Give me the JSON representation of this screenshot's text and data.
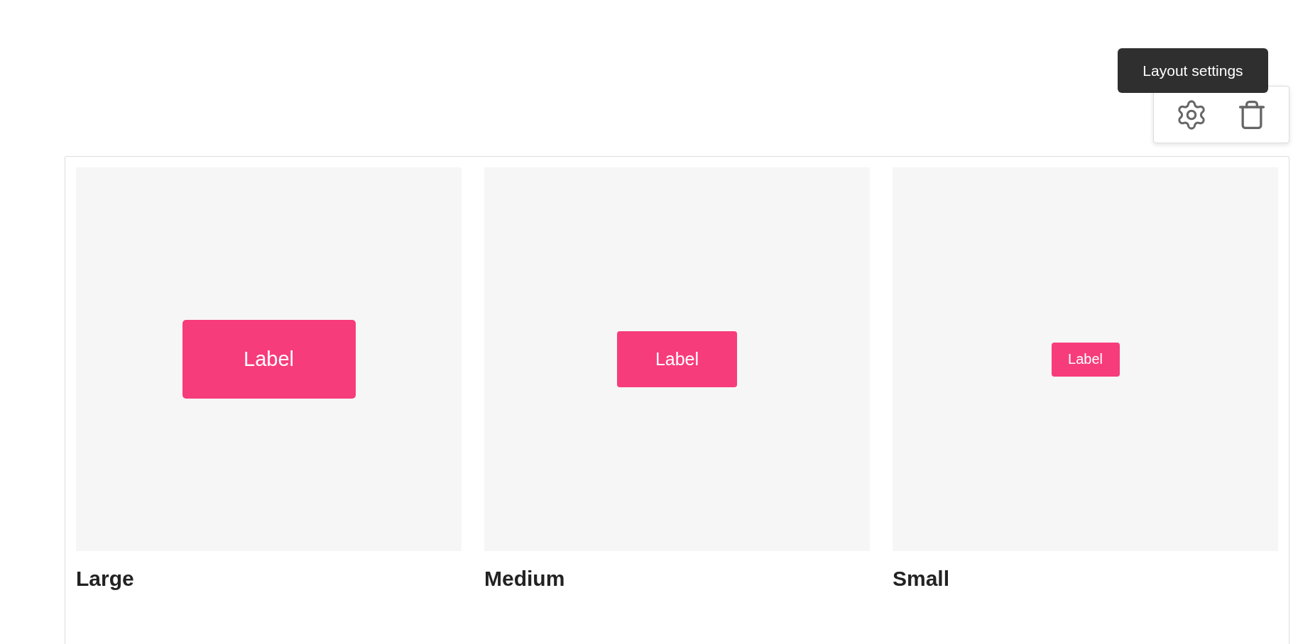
{
  "toolbar": {
    "tooltip": "Layout settings",
    "icons": [
      {
        "kind": "settings"
      },
      {
        "kind": "delete"
      }
    ]
  },
  "examples": [
    {
      "kind": "large",
      "button_label": "Label",
      "caption": "Large"
    },
    {
      "kind": "medium",
      "button_label": "Label",
      "caption": "Medium"
    },
    {
      "kind": "small",
      "button_label": "Label",
      "caption": "Small"
    }
  ]
}
